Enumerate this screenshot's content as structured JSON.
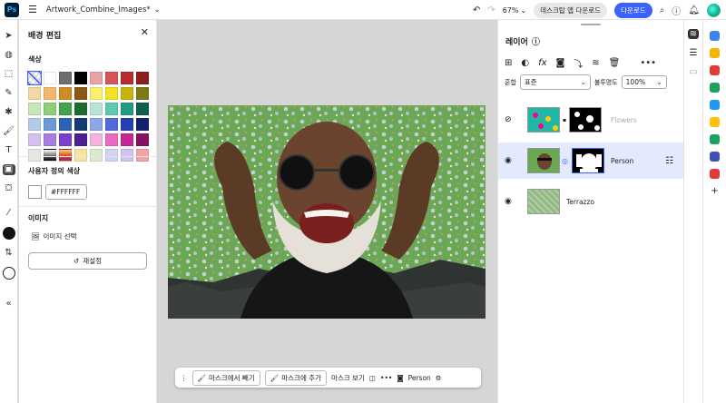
{
  "app": {
    "logo": "Ps",
    "document_title": "Artwork_Combine_Images*"
  },
  "topbar": {
    "zoom": "67%",
    "download_desktop": "데스크탑 앱 다운로드",
    "download": "다운로드"
  },
  "left_panel": {
    "title": "배경 편집",
    "color_section": "색상",
    "custom_color_section": "사용자 정의 색상",
    "hex_value": "#FFFFFF",
    "image_section": "이미지",
    "select_image": "이미지 선택",
    "reset": "재설정",
    "swatches": [
      "transparent",
      "#ffffff",
      "#6e6e6e",
      "#000000",
      "#e9a3a7",
      "#d65656",
      "#b92b2f",
      "#8d1f22",
      "#f5d7a6",
      "#f3b66a",
      "#d18b25",
      "#8a5a14",
      "#faf06c",
      "#f5e023",
      "#c8b40f",
      "#7c7a16",
      "#c7e5b6",
      "#8dcf7b",
      "#3fa54a",
      "#1d6b30",
      "#b6e5d8",
      "#5ec9b0",
      "#1f9c84",
      "#0e5e52",
      "#b3cce6",
      "#6c9ad7",
      "#2c61b8",
      "#163a73",
      "#8ea7ea",
      "#4f6ad9",
      "#2341b3",
      "#14226b",
      "#d5bff0",
      "#a67de0",
      "#7b3fce",
      "#4b2091",
      "#f2b3df",
      "#e66bc2",
      "#c72697",
      "#851164",
      "#e6e6e6",
      "#505050",
      "#f8c060",
      "#f4e5a3",
      "#d8eccd",
      "#d1d4f0",
      "#cfc3ef",
      "#f2a3a8"
    ]
  },
  "bottom_bar": {
    "subtract": "마스크에서 빼기",
    "add": "마스크에 추가",
    "view_mask": "마스크 보기",
    "layer_name": "Person"
  },
  "layers_panel": {
    "title": "레이어",
    "blend_label": "혼합",
    "blend_mode": "표준",
    "opacity_label": "불투명도",
    "opacity_value": "100%",
    "layers": [
      {
        "name": "Flowers",
        "visible": false,
        "active": false
      },
      {
        "name": "Person",
        "visible": true,
        "active": true
      },
      {
        "name": "Terrazzo",
        "visible": true,
        "active": false
      }
    ]
  },
  "icons": {
    "left_tools": [
      "move-icon",
      "lasso-icon",
      "select-subject-icon",
      "healing-icon",
      "quick-action-icon",
      "brush-icon",
      "text-icon",
      "background-icon",
      "stamp-icon",
      "eyedropper-icon"
    ],
    "right_rail": [
      "layers-icon",
      "adjustments-icon",
      "comments-icon"
    ]
  }
}
